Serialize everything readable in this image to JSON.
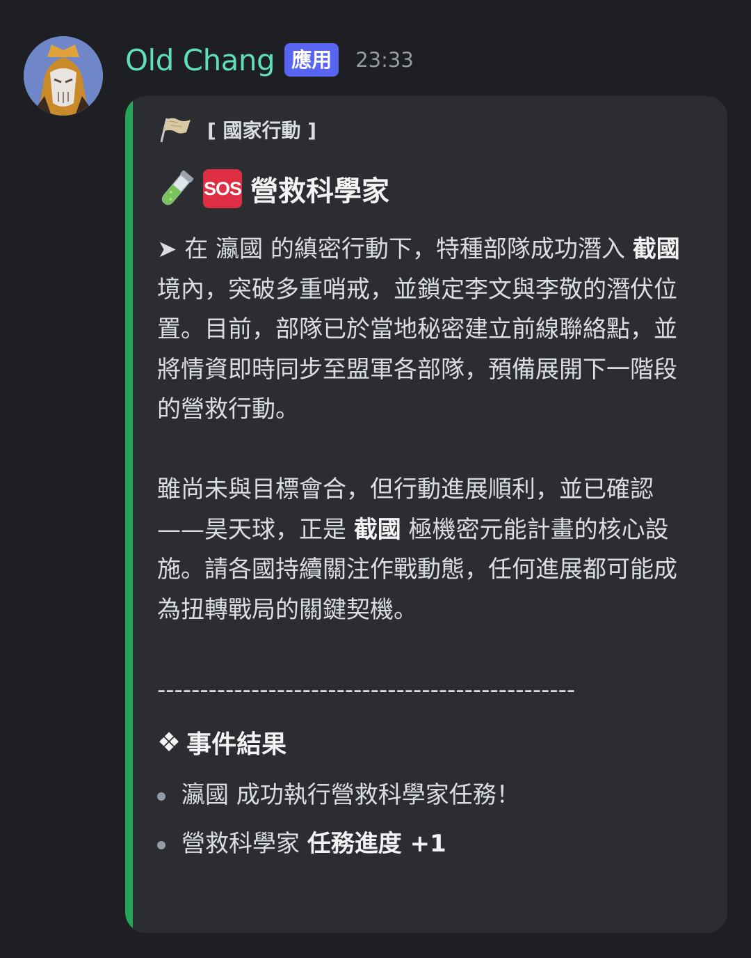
{
  "message": {
    "username": "Old Chang",
    "app_badge": "應用",
    "timestamp": "23:33"
  },
  "embed": {
    "accent_color": "#23a55a",
    "author": "[ 國家行動 ]",
    "author_icon": "flag-icon",
    "title": "營救科學家",
    "title_icons": [
      "test-tube-icon",
      "sos-icon"
    ],
    "sos_label": "SOS",
    "paragraph1": {
      "arrow": "➤",
      "t1": " 在 瀛國 的縝密行動下，特種部隊成功潛入 ",
      "b1": "截國",
      "t2": " 境內，突破多重哨戒，並鎖定李文與李敬的潛伏位置。目前，部隊已於當地秘密建立前線聯絡點，並將情資即時同步至盟軍各部隊，預備展開下一階段的營救行動。"
    },
    "paragraph2": {
      "t1": "雖尚未與目標會合，但行動進展順利，並已確認——昊天球，正是 ",
      "b1": "截國",
      "t2": " 極機密元能計畫的核心設施。請各國持續關注作戰動態，任何進展都可能成為扭轉戰局的關鍵契機。"
    },
    "divider": "-------------------------------------------------",
    "result_icon": "❖",
    "result_title": "事件結果",
    "results": [
      {
        "text": "瀛國 成功執行營救科學家任務！",
        "bold": ""
      },
      {
        "text": "營救科學家 ",
        "bold": "任務進度 +1"
      }
    ]
  }
}
